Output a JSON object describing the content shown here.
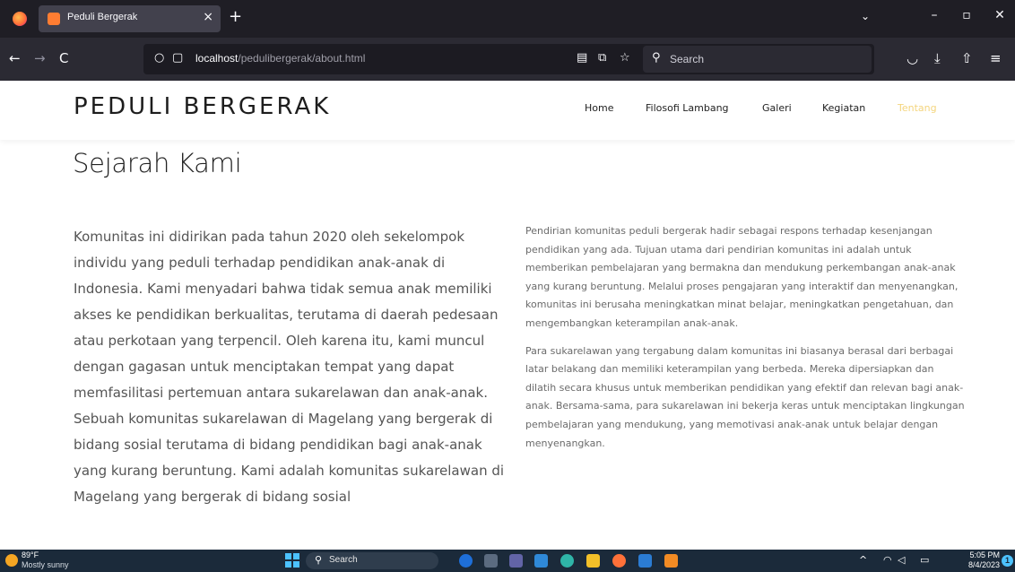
{
  "browser": {
    "tab_title": "Peduli Bergerak",
    "tab_close": "×",
    "new_tab": "+",
    "url_host": "localhost",
    "url_path": "/pedulibergerak/about.html",
    "search_placeholder": "Search",
    "icons": {
      "back": "←",
      "forward": "→",
      "reload": "C",
      "shield": "○",
      "page": "▢",
      "reader": "▤",
      "translate": "⧉",
      "bookmark": "☆",
      "search": "⚲",
      "pocket": "◡",
      "download": "⤓",
      "extensions": "⇧",
      "menu": "≡",
      "tab_list": "⌄",
      "minimize": "–",
      "restore": "▫",
      "close": "✕"
    }
  },
  "site": {
    "brand": "PEDULI BERGERAK",
    "nav": [
      {
        "label": "Home"
      },
      {
        "label": "Filosofi Lambang"
      },
      {
        "label": "Galeri"
      },
      {
        "label": "Kegiatan"
      },
      {
        "label": "Tentang",
        "active": true
      }
    ],
    "active_color": "#f4d57e"
  },
  "page": {
    "title": "Sejarah Kami",
    "left_paragraph": "Komunitas ini didirikan pada tahun 2020 oleh sekelompok individu yang peduli terhadap pendidikan anak-anak di Indonesia. Kami menyadari bahwa tidak semua anak memiliki akses ke pendidikan berkualitas, terutama di daerah pedesaan atau perkotaan yang terpencil. Oleh karena itu, kami muncul dengan gagasan untuk menciptakan tempat yang dapat memfasilitasi pertemuan antara sukarelawan dan anak-anak. Sebuah komunitas sukarelawan di Magelang yang bergerak di bidang sosial terutama di bidang pendidikan bagi anak-anak yang kurang beruntung. Kami adalah komunitas sukarelawan di Magelang yang bergerak di bidang sosial",
    "right_paragraphs": [
      "Pendirian komunitas peduli bergerak hadir sebagai respons terhadap kesenjangan pendidikan yang ada. Tujuan utama dari pendirian komunitas ini adalah untuk memberikan pembelajaran yang bermakna dan mendukung perkembangan anak-anak yang kurang beruntung. Melalui proses pengajaran yang interaktif dan menyenangkan, komunitas ini berusaha meningkatkan minat belajar, meningkatkan pengetahuan, dan mengembangkan keterampilan anak-anak.",
      "Para sukarelawan yang tergabung dalam komunitas ini biasanya berasal dari berbagai latar belakang dan memiliki keterampilan yang berbeda. Mereka dipersiapkan dan dilatih secara khusus untuk memberikan pendidikan yang efektif dan relevan bagi anak-anak. Bersama-sama, para sukarelawan ini bekerja keras untuk menciptakan lingkungan pembelajaran yang mendukung, yang memotivasi anak-anak untuk belajar dengan menyenangkan."
    ]
  },
  "taskbar": {
    "weather_temp": "89°F",
    "weather_desc": "Mostly sunny",
    "search_label": "Search",
    "time": "5:05 PM",
    "date": "8/4/2023",
    "notification_count": "1",
    "tray": {
      "chevron": "^",
      "wifi": "◠",
      "volume": "◁",
      "battery": "▭"
    }
  }
}
